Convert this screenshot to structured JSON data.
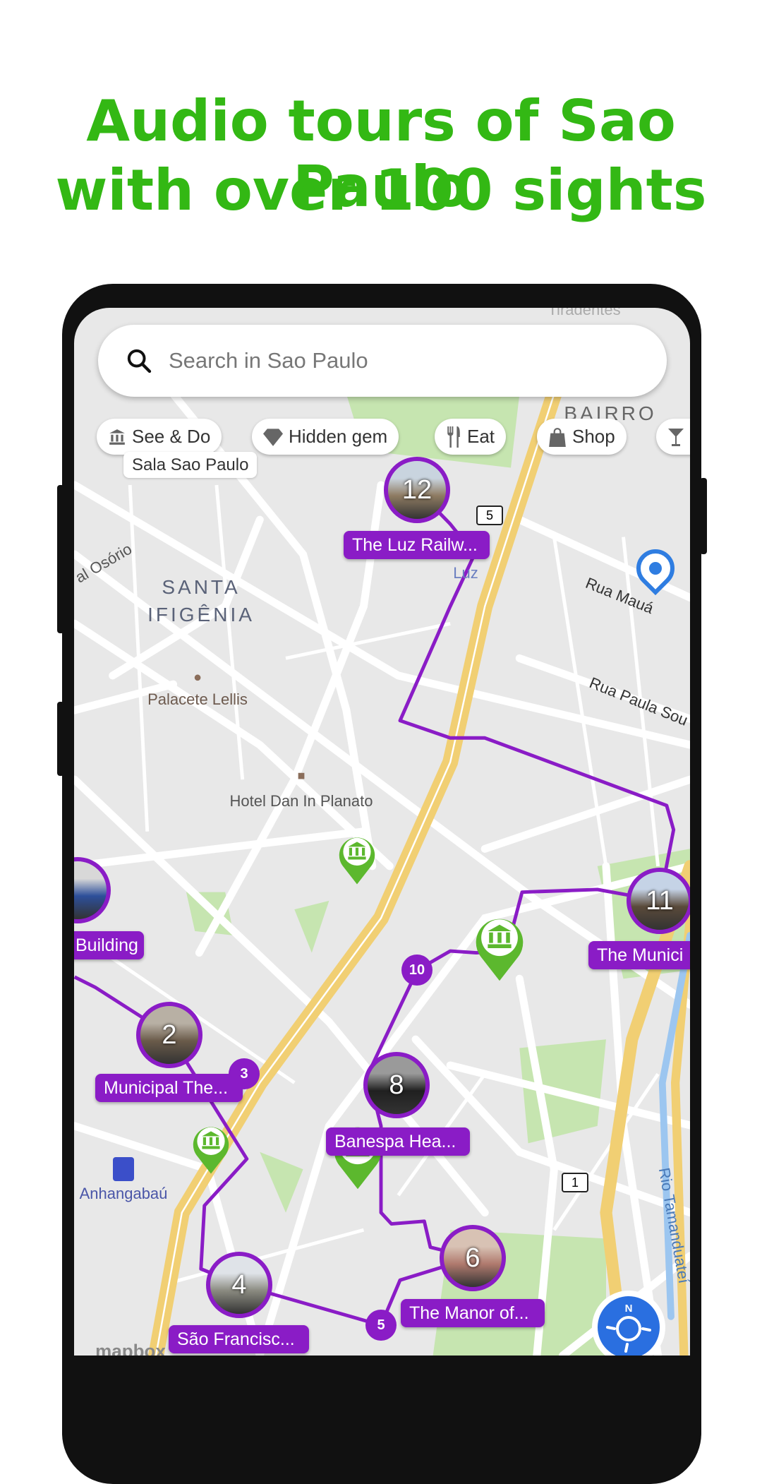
{
  "headline": {
    "line1": "Audio tours of Sao Paulo",
    "line2": "with over 100 sights"
  },
  "search": {
    "placeholder": "Search in Sao Paulo",
    "icon": "search-icon"
  },
  "chips": [
    {
      "label": "See & Do",
      "icon": "museum-icon"
    },
    {
      "label": "Hidden gem",
      "icon": "diamond-icon"
    },
    {
      "label": "Eat",
      "icon": "fork-knife-icon"
    },
    {
      "label": "Shop",
      "icon": "shopping-bag-icon"
    },
    {
      "label": "",
      "icon": "cocktail-icon"
    }
  ],
  "map_labels": {
    "tiradentes": "Tiradentes",
    "bairro": "BAIRRO",
    "sala": "Sala Sao Paulo",
    "luz": "Luz",
    "osorio": "al Osório",
    "santa": "SANTA",
    "ifigenia": "IFIGÊNIA",
    "rua_maua": "Rua Mauá",
    "rua_paula": "Rua Paula Sou",
    "palacete": "Palacete Lellis",
    "hotel": "Hotel Dan In Planato",
    "anhangabau": "Anhangabaú",
    "rio": "Rio Tamanduateí",
    "mapbox": "mapbox"
  },
  "route_badges": [
    "5",
    "1"
  ],
  "stops": [
    {
      "number": "12",
      "label": "The Luz Railw..."
    },
    {
      "number": "",
      "label": "Building"
    },
    {
      "number": "11",
      "label": "The Munici"
    },
    {
      "number": "2",
      "label": "Municipal The..."
    },
    {
      "number": "8",
      "label": "Banespa Hea..."
    },
    {
      "number": "6",
      "label": "The Manor of..."
    },
    {
      "number": "4",
      "label": "São Francisc..."
    }
  ],
  "small_stops": [
    "10",
    "3",
    "5"
  ],
  "compass": {
    "label": "N"
  },
  "colors": {
    "headline": "#33b814",
    "route": "#8a1cc6",
    "pin": "#5cb82e",
    "location": "#2f7de1",
    "compass": "#2a6fe0"
  }
}
